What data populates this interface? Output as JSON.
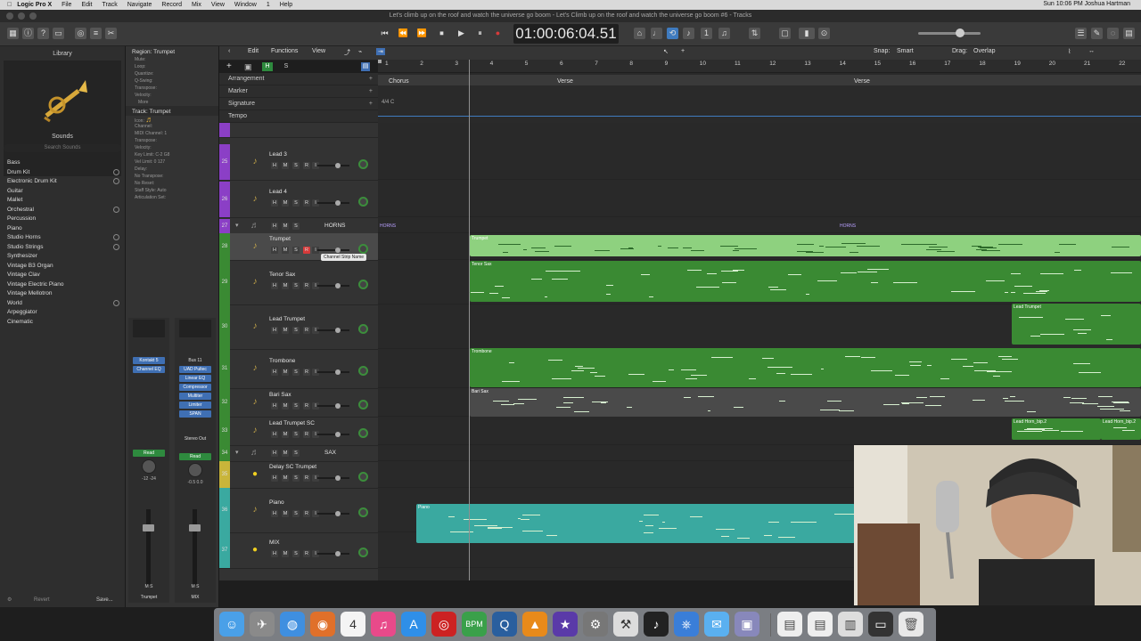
{
  "menubar": {
    "app": "Logic Pro X",
    "items": [
      "File",
      "Edit",
      "Track",
      "Navigate",
      "Record",
      "Mix",
      "View",
      "Window",
      "1",
      "Help"
    ],
    "status": "Sun 10:06 PM  Joshua Hartman"
  },
  "window": {
    "title": "Let's climb up on the roof and watch the universe go boom - Let's Climb up on the roof and watch the universe go boom #6 - Tracks"
  },
  "control_bar": {
    "lcd": "01:00:06:04.51",
    "lcd_sub": "1 1 1 1"
  },
  "library": {
    "title": "Library",
    "sounds_label": "Sounds",
    "search_placeholder": "Search Sounds",
    "items": [
      {
        "label": "Bass",
        "download": false
      },
      {
        "label": "Drum Kit",
        "download": true
      },
      {
        "label": "Electronic Drum Kit",
        "download": true
      },
      {
        "label": "Guitar",
        "download": false
      },
      {
        "label": "Mallet",
        "download": false
      },
      {
        "label": "Orchestral",
        "download": true
      },
      {
        "label": "Percussion",
        "download": false
      },
      {
        "label": "Piano",
        "download": false
      },
      {
        "label": "Studio Horns",
        "download": true
      },
      {
        "label": "Studio Strings",
        "download": true
      },
      {
        "label": "Synthesizer",
        "download": false
      },
      {
        "label": "Vintage B3 Organ",
        "download": false
      },
      {
        "label": "Vintage Clav",
        "download": false
      },
      {
        "label": "Vintage Electric Piano",
        "download": false
      },
      {
        "label": "Vintage Mellotron",
        "download": false
      },
      {
        "label": "World",
        "download": true
      },
      {
        "label": "Arpeggiator",
        "download": false
      },
      {
        "label": "Cinematic",
        "download": false
      }
    ],
    "revert": "Revert",
    "save": "Save..."
  },
  "inspector": {
    "region_header": "Region: Trumpet",
    "region_rows": [
      "Mute:",
      "Loop:",
      "Quantize:",
      "Q-Swing:",
      "Transpose:",
      "Velocity:"
    ],
    "more": "More",
    "track_header": "Track: Trumpet",
    "track_rows": [
      "Icon:",
      "Channel:",
      "MIDI Channel: 1",
      "Transpose:",
      "Velocity:",
      "Key Limit: C-2 G8",
      "Vel Limit: 0 127",
      "Delay:",
      "No Transpose:",
      "No Reset:",
      "Staff Style: Auto",
      "Articulation Set:"
    ],
    "strip_left": {
      "slots": [
        "Kontakt 5",
        "Channel EQ"
      ],
      "value_a": "-12",
      "value_b": "-24",
      "mode": "Read",
      "name": "Trumpet",
      "bottom": "M S"
    },
    "strip_right": {
      "slots": [
        "Bus 11",
        "UAD Pultec",
        "Linear EQ",
        "Compressor",
        "Multiter",
        "Limiter",
        "SPAN"
      ],
      "output": "Stereo Out",
      "value_a": "-0.5",
      "value_b": "0.0",
      "mode": "Read",
      "name": "MIX",
      "bottom": "M S"
    }
  },
  "tracks_toolbar": {
    "edit": "Edit",
    "functions": "Functions",
    "view": "View",
    "snap_label": "Snap:",
    "snap_value": "Smart",
    "drag_label": "Drag:",
    "drag_value": "Overlap"
  },
  "ruler": {
    "bars": [
      "1",
      "2",
      "3",
      "4",
      "5",
      "6",
      "7",
      "8",
      "9",
      "10",
      "11",
      "12",
      "13",
      "14",
      "15",
      "16",
      "17",
      "18",
      "19",
      "20",
      "21",
      "22"
    ]
  },
  "global_tracks": [
    {
      "label": "Arrangement"
    },
    {
      "label": "Marker"
    },
    {
      "label": "Signature"
    },
    {
      "label": "Tempo"
    }
  ],
  "arrangement_markers": [
    "Chorus",
    "Verse",
    "Verse"
  ],
  "tracks": [
    {
      "num": "25",
      "name": "Lead 3"
    },
    {
      "num": "26",
      "name": "Lead 4"
    },
    {
      "num": "27",
      "name": "HORNS"
    },
    {
      "num": "28",
      "name": "Trumpet"
    },
    {
      "num": "29",
      "name": "Tenor Sax"
    },
    {
      "num": "30",
      "name": "Lead Trumpet"
    },
    {
      "num": "31",
      "name": "Trombone"
    },
    {
      "num": "32",
      "name": "Bari Sax"
    },
    {
      "num": "33",
      "name": "Lead Trumpet SC"
    },
    {
      "num": "34",
      "name": "SAX"
    },
    {
      "num": "35",
      "name": "Delay SC Trumpet"
    },
    {
      "num": "36",
      "name": "Piano"
    },
    {
      "num": "37",
      "name": "MIX"
    }
  ],
  "tooltip": "Channel Strip Name",
  "regions": {
    "horns_a": "HORNS",
    "horns_b": "HORNS",
    "trumpet": "Trumpet",
    "tenor": "Tenor Sax",
    "lead_trumpet": "Lead Trumpet",
    "trombone": "Trombone",
    "bari": "Bari Sax",
    "lead_horn_a": "Lead Horn_bip.2",
    "lead_horn_b": "Lead Horn_bip.2",
    "piano": "Piano"
  },
  "colors": {
    "green_region": "#3a8a33",
    "selected_region": "#8ed17f",
    "cyan_region": "#3aa9a0",
    "record_red": "#d63a3a"
  }
}
